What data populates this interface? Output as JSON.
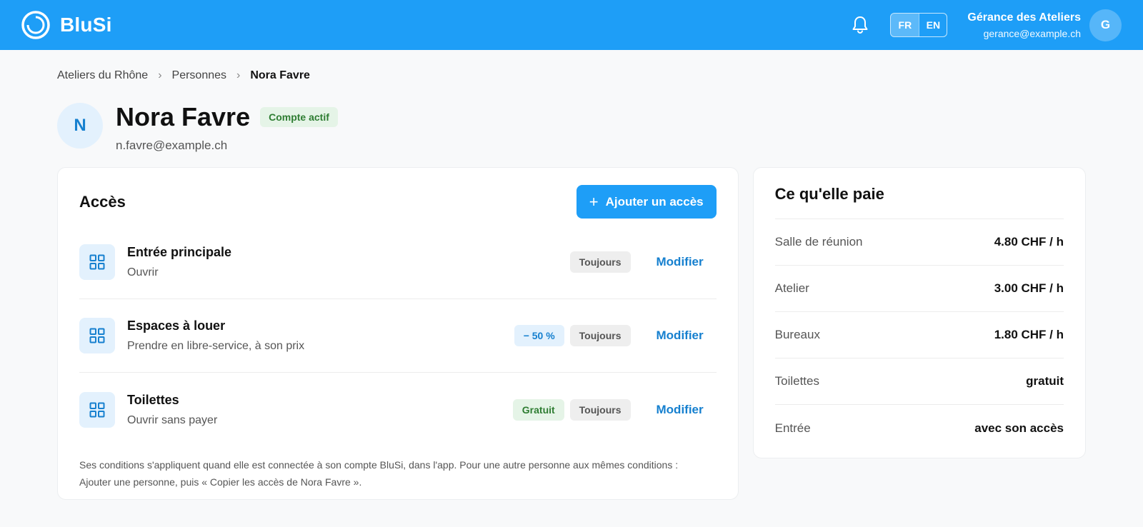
{
  "header": {
    "brand": "BluSi",
    "languages": [
      {
        "code": "FR",
        "active": true
      },
      {
        "code": "EN",
        "active": false
      }
    ],
    "account_name": "Gérance des Ateliers",
    "account_email": "gerance@example.ch",
    "avatar_initial": "G",
    "brand_color": "#1e9ef7"
  },
  "breadcrumb": {
    "items": [
      "Ateliers du Rhône",
      "Personnes",
      "Nora Favre"
    ],
    "separator": "›"
  },
  "profile": {
    "initial": "N",
    "name": "Nora Favre",
    "status": "Compte actif",
    "email": "n.favre@example.ch"
  },
  "access": {
    "title": "Accès",
    "add_button": "Ajouter un accès",
    "modify_label": "Modifier",
    "items": [
      {
        "title": "Entrée principale",
        "subtitle": "Ouvrir",
        "tags": [
          "Toujours"
        ]
      },
      {
        "title": "Espaces à louer",
        "subtitle": "Prendre en libre-service, à son prix",
        "discount": "− 50 %",
        "tags": [
          "Toujours"
        ]
      },
      {
        "title": "Toilettes",
        "subtitle": "Ouvrir sans payer",
        "free": "Gratuit",
        "tags": [
          "Toujours"
        ]
      }
    ],
    "footnote": "Ses conditions s'appliquent quand elle est connectée à son compte BluSi, dans l'app. Pour une autre personne aux mêmes conditions : Ajouter une personne, puis « Copier les accès de Nora Favre »."
  },
  "pays": {
    "title": "Ce qu'elle paie",
    "rows": [
      {
        "label": "Salle de réunion",
        "value": "4.80 CHF / h"
      },
      {
        "label": "Atelier",
        "value": "3.00 CHF / h"
      },
      {
        "label": "Bureaux",
        "value": "1.80 CHF / h"
      },
      {
        "label": "Toilettes",
        "value": "gratuit"
      },
      {
        "label": "Entrée",
        "value": "avec son accès"
      }
    ]
  }
}
